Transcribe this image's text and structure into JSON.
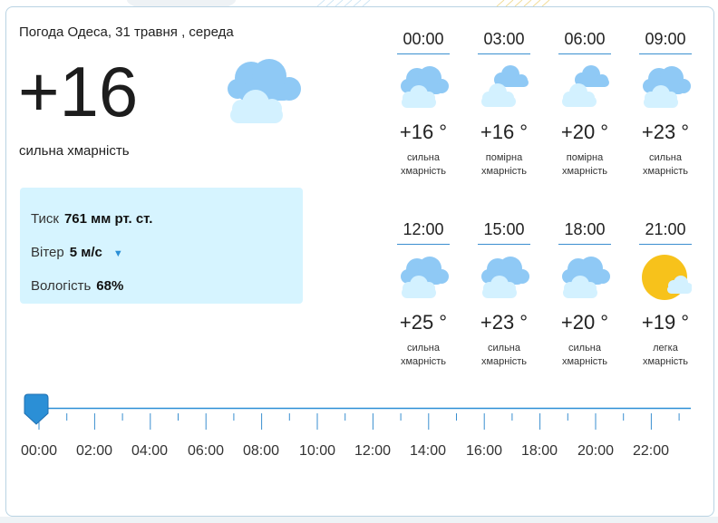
{
  "current": {
    "title": "Погода Одеса, 31 травня , середа",
    "temperature": "+16",
    "description": "сильна хмарність",
    "icon": "cloudy-icon",
    "pressure_label": "Тиск",
    "pressure_value": "761 мм рт. ст.",
    "wind_label": "Вітер",
    "wind_value": "5 м/с",
    "wind_icon": "wind-direction-arrow-icon",
    "humidity_label": "Вологість",
    "humidity_value": "68%"
  },
  "forecast": [
    {
      "time": "00:00",
      "temp": "+16 °",
      "desc1": "сильна",
      "desc2": "хмарність",
      "icon": "cloudy-icon"
    },
    {
      "time": "03:00",
      "temp": "+16 °",
      "desc1": "помірна",
      "desc2": "хмарність",
      "icon": "partly-cloudy-icon"
    },
    {
      "time": "06:00",
      "temp": "+20 °",
      "desc1": "помірна",
      "desc2": "хмарність",
      "icon": "partly-cloudy-icon"
    },
    {
      "time": "09:00",
      "temp": "+23 °",
      "desc1": "сильна",
      "desc2": "хмарність",
      "icon": "cloudy-icon"
    },
    {
      "time": "12:00",
      "temp": "+25 °",
      "desc1": "сильна",
      "desc2": "хмарність",
      "icon": "cloudy-icon"
    },
    {
      "time": "15:00",
      "temp": "+23 °",
      "desc1": "сильна",
      "desc2": "хмарність",
      "icon": "cloudy-icon"
    },
    {
      "time": "18:00",
      "temp": "+20 °",
      "desc1": "сильна",
      "desc2": "хмарність",
      "icon": "cloudy-icon"
    },
    {
      "time": "21:00",
      "temp": "+19 °",
      "desc1": "легка",
      "desc2": "хмарність",
      "icon": "sun-with-cloud-icon"
    }
  ],
  "timeline": {
    "labels": [
      "00:00",
      "02:00",
      "04:00",
      "06:00",
      "08:00",
      "10:00",
      "12:00",
      "14:00",
      "16:00",
      "18:00",
      "20:00",
      "22:00"
    ],
    "selected": "00:00"
  },
  "colors": {
    "accent": "#2b8fd6",
    "cloud_front": "#d3f1ff",
    "cloud_back": "#8fc9f5",
    "sun": "#f7c21b",
    "details_bg": "#d6f4ff"
  }
}
